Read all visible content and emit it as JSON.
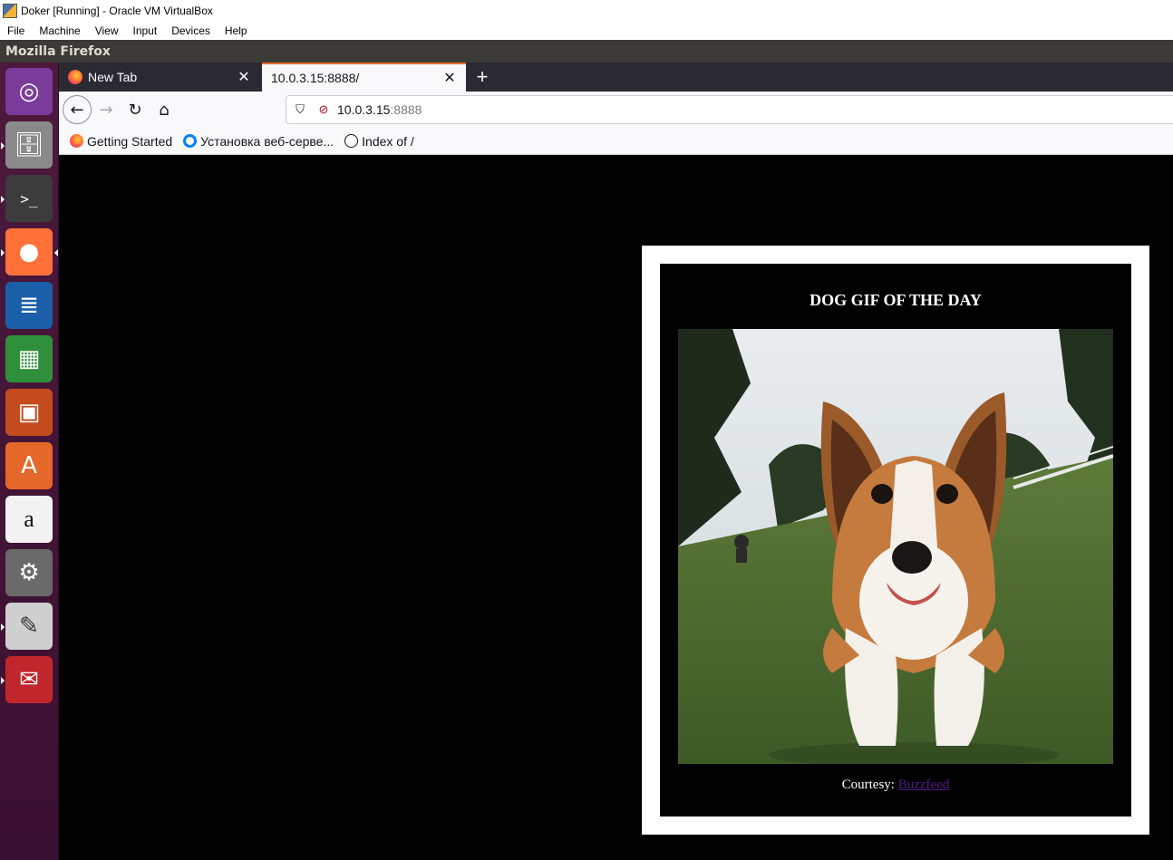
{
  "virtualbox": {
    "title": "Doker [Running] - Oracle VM VirtualBox",
    "menu": [
      "File",
      "Machine",
      "View",
      "Input",
      "Devices",
      "Help"
    ]
  },
  "ubuntu_panel": {
    "title": "Mozilla Firefox"
  },
  "launcher": {
    "items": [
      {
        "name": "ubuntu-dash-icon",
        "glyph": "◎",
        "color": "#7b3b9a"
      },
      {
        "name": "files-icon",
        "glyph": "🗄",
        "color": "#8a8a8a"
      },
      {
        "name": "terminal-icon",
        "glyph": ">_",
        "color": "#3c3c3c"
      },
      {
        "name": "firefox-icon",
        "glyph": "●",
        "color": "#ff7139"
      },
      {
        "name": "writer-icon",
        "glyph": "≣",
        "color": "#1a5fa8"
      },
      {
        "name": "calc-icon",
        "glyph": "▦",
        "color": "#2f8f3a"
      },
      {
        "name": "impress-icon",
        "glyph": "▣",
        "color": "#c44b1e"
      },
      {
        "name": "software-center-icon",
        "glyph": "A",
        "color": "#e5672a"
      },
      {
        "name": "amazon-icon",
        "glyph": "a",
        "color": "#f2f2f2"
      },
      {
        "name": "system-settings-icon",
        "glyph": "⚙",
        "color": "#6a6a6a"
      },
      {
        "name": "text-editor-icon",
        "glyph": "✎",
        "color": "#cfcfcf"
      },
      {
        "name": "document-viewer-icon",
        "glyph": "✉",
        "color": "#c0262c"
      }
    ]
  },
  "tabs": [
    {
      "label": "New Tab",
      "active": false
    },
    {
      "label": "10.0.3.15:8888/",
      "active": true
    }
  ],
  "urlbar": {
    "host": "10.0.3.15",
    "port": ":8888"
  },
  "bookmarks": [
    {
      "label": "Getting Started",
      "icon": "firefox-icon"
    },
    {
      "label": "Установка веб-серве...",
      "icon": "digitalocean-icon"
    },
    {
      "label": "Index of /",
      "icon": "globe-icon"
    }
  ],
  "page": {
    "heading": "DOG GIF OF THE DAY",
    "caption_prefix": "Courtesy: ",
    "caption_link": "Buzzfeed"
  }
}
